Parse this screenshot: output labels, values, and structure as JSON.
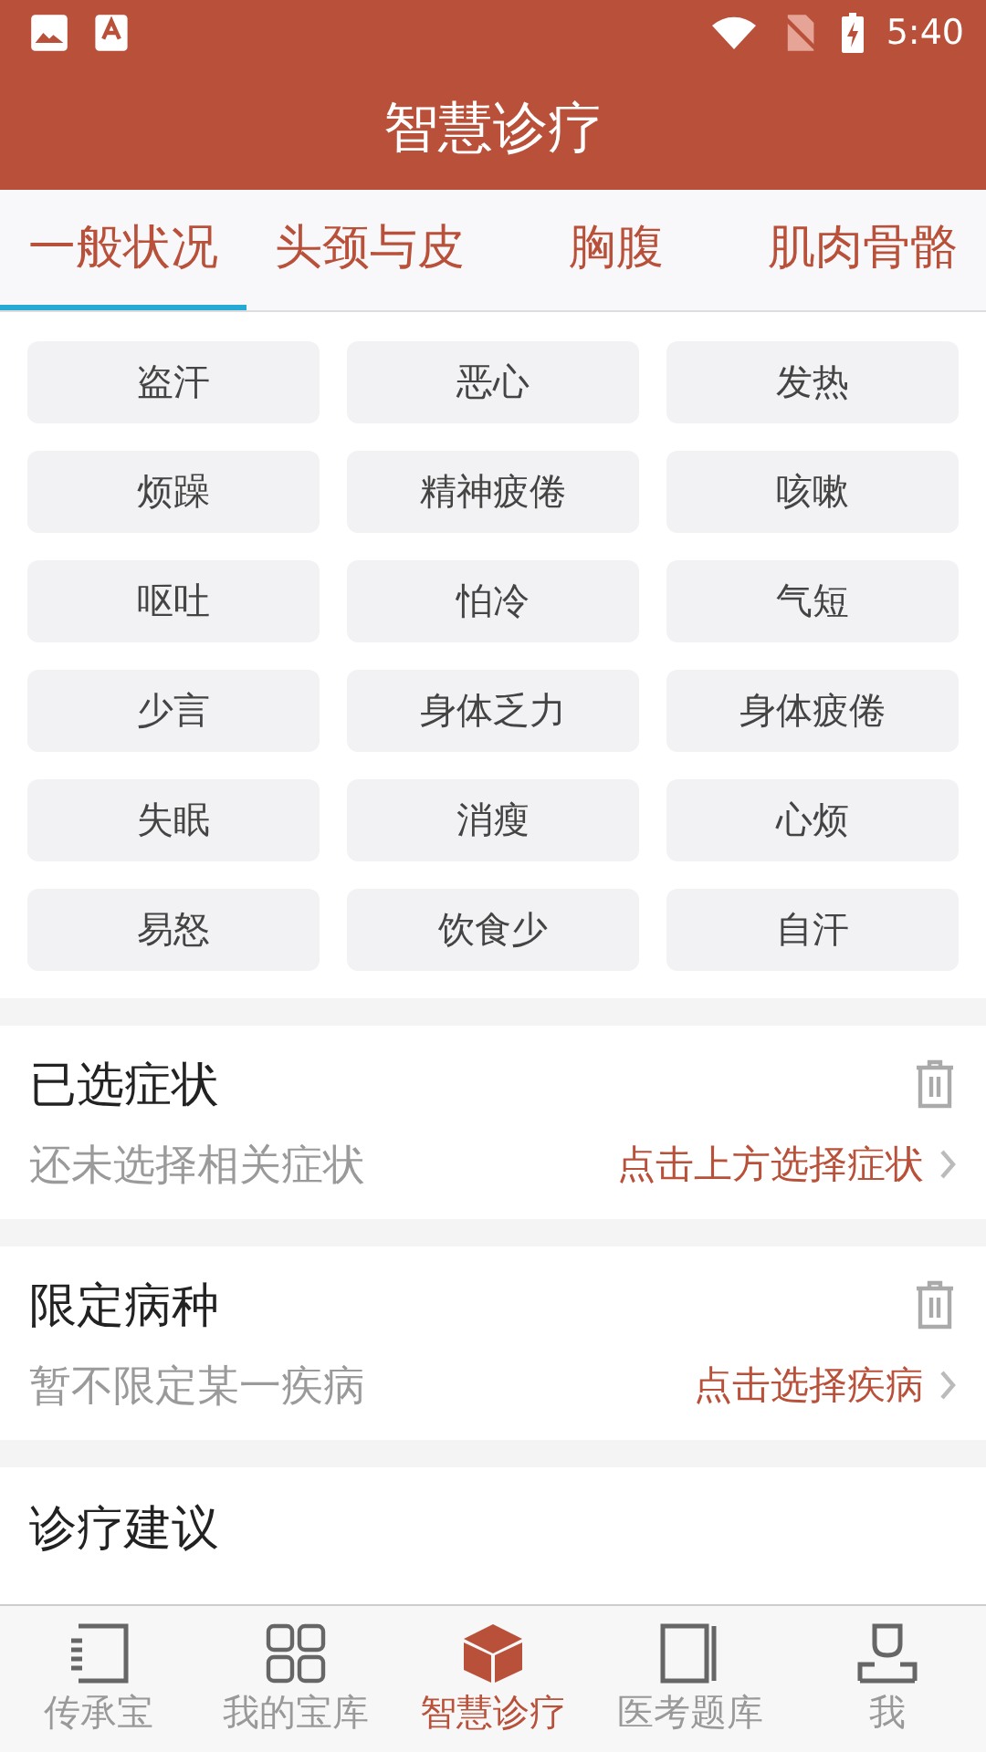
{
  "status_bar": {
    "time": "5:40"
  },
  "app_bar": {
    "title": "智慧诊疗"
  },
  "tabs": [
    {
      "label": "一般状况",
      "selected": true
    },
    {
      "label": "头颈与皮",
      "selected": false
    },
    {
      "label": "胸腹",
      "selected": false
    },
    {
      "label": "肌肉骨骼",
      "selected": false
    }
  ],
  "symptoms": [
    "盗汗",
    "恶心",
    "发热",
    "烦躁",
    "精神疲倦",
    "咳嗽",
    "呕吐",
    "怕冷",
    "气短",
    "少言",
    "身体乏力",
    "身体疲倦",
    "失眠",
    "消瘦",
    "心烦",
    "易怒",
    "饮食少",
    "自汗"
  ],
  "sections": [
    {
      "title": "已选症状",
      "hint": "还未选择相关症状",
      "action": "点击上方选择症状"
    },
    {
      "title": "限定病种",
      "hint": "暂不限定某一疾病",
      "action": "点击选择疾病"
    }
  ],
  "advice": {
    "title": "诊疗建议"
  },
  "bottom_nav": [
    {
      "label": "传承宝",
      "selected": false
    },
    {
      "label": "我的宝库",
      "selected": false
    },
    {
      "label": "智慧诊疗",
      "selected": true
    },
    {
      "label": "医考题库",
      "selected": false
    },
    {
      "label": "我",
      "selected": false
    }
  ]
}
